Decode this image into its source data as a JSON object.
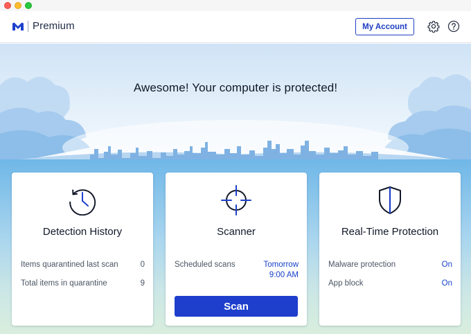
{
  "window": {
    "controls": [
      "close",
      "minimize",
      "maximize"
    ]
  },
  "header": {
    "logo_icon": "malwarebytes-logo-icon",
    "brand": "Premium",
    "account_button": "My Account",
    "settings_icon": "gear-icon",
    "help_icon": "help-icon"
  },
  "hero": {
    "status_message": "Awesome! Your computer is protected!"
  },
  "cards": {
    "detection": {
      "icon": "history-clock-icon",
      "title": "Detection History",
      "rows": [
        {
          "label": "Items quarantined last scan",
          "value": "0"
        },
        {
          "label": "Total items in quarantine",
          "value": "9"
        }
      ]
    },
    "scanner": {
      "icon": "crosshair-icon",
      "title": "Scanner",
      "rows": [
        {
          "label": "Scheduled scans",
          "value_line1": "Tomorrow",
          "value_line2": "9:00 AM"
        }
      ],
      "scan_button": "Scan"
    },
    "realtime": {
      "icon": "shield-icon",
      "title": "Real-Time Protection",
      "rows": [
        {
          "label": "Malware protection",
          "value": "On"
        },
        {
          "label": "App block",
          "value": "On"
        }
      ]
    }
  },
  "colors": {
    "accent": "#1d3fcc",
    "link_blue": "#1742c9",
    "text_dark": "#111827",
    "text_muted": "#4b5563"
  }
}
